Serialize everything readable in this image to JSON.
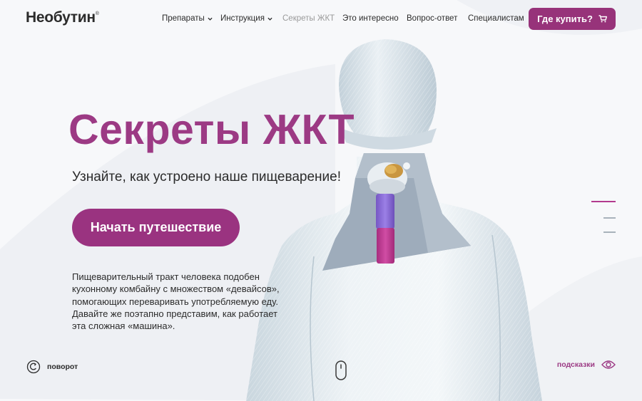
{
  "header": {
    "logo": "Необутин",
    "logo_mark": "®",
    "nav": [
      {
        "label": "Препараты",
        "has_dropdown": true
      },
      {
        "label": "Инструкция",
        "has_dropdown": true
      },
      {
        "label": "Секреты ЖКТ",
        "has_dropdown": false,
        "active": true
      },
      {
        "label": "Это интересно",
        "has_dropdown": false
      },
      {
        "label": "Вопрос-ответ",
        "has_dropdown": false
      },
      {
        "label": "Специалистам",
        "has_dropdown": false
      }
    ],
    "buy_label": "Где купить?",
    "buy_icon": "cart-icon"
  },
  "hero": {
    "title": "Секреты ЖКТ",
    "subtitle": "Узнайте, как устроено наше пищеварение!",
    "start_label": "Начать путешествие",
    "description": "Пищеварительный тракт человека подобен кухонному комбайну с множеством «девайсов», помогающих переваривать употребляемую еду. Давайте же поэтапно представим, как работает эта сложная «машина»."
  },
  "controls": {
    "rotate_label": "поворот",
    "rotate_icon": "rotate-icon",
    "hints_label": "подсказки",
    "hints_icon": "eye-icon",
    "scroll_icon": "mouse-scroll-icon"
  },
  "pager": {
    "count": 3,
    "active_index": 0
  },
  "colors": {
    "brand": "#9c3a84",
    "button": "#97337a",
    "esophagus_upper": "#8a6bd6",
    "esophagus_lower": "#c03d94",
    "body": "#dfe8ee",
    "background": "#f7f8fa"
  }
}
